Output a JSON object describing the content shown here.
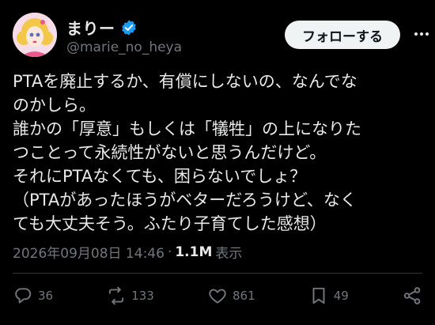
{
  "author": {
    "display_name": "まりー",
    "handle": "@marie_no_heya"
  },
  "follow_label": "フォローする",
  "post": {
    "lines": [
      "PTAを廃止するか、有償にしないの、なんでな",
      "のかしら。",
      "誰かの「厚意」もしくは「犠牲」の上になりた",
      "つことって永続性がないと思うんだけど。",
      "それにPTAなくても、困らないでしょ？",
      "（PTAがあったほうがベターだろうけど、なく",
      "ても大丈夫そう。ふたり子育てした感想）"
    ]
  },
  "meta": {
    "timestamp": "2026年09月08日 14:46",
    "separator": "·",
    "views_count": "1.1M",
    "views_label": "表示"
  },
  "actions": {
    "replies": "36",
    "reposts": "133",
    "likes": "861",
    "bookmarks": "49"
  },
  "colors": {
    "background": "#000000",
    "text": "#e7e9ea",
    "muted": "#71767b",
    "verified": "#1d9bf0",
    "button_bg": "#eff3f4"
  }
}
